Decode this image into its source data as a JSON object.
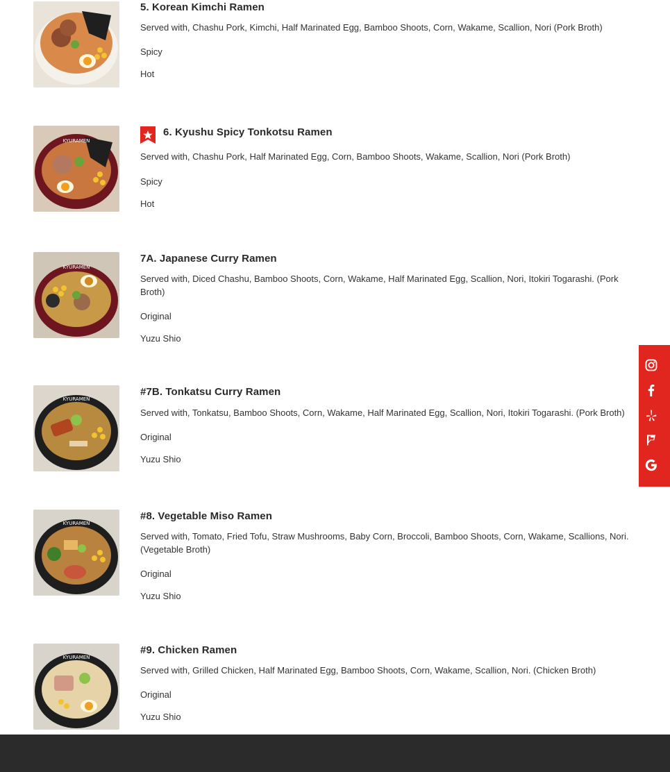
{
  "menu": {
    "items": [
      {
        "title": "5. Korean Kimchi Ramen",
        "featured": false,
        "description": "Served with, Chashu Pork, Kimchi, Half Marinated Egg, Bamboo Shoots, Corn, Wakame, Scallion, Nori (Pork Broth)",
        "options": [
          "Spicy",
          "Hot"
        ],
        "broth_color": "#d98a4a"
      },
      {
        "title": "6. Kyushu Spicy Tonkotsu Ramen",
        "featured": true,
        "description": "Served with, Chashu Pork, Half Marinated Egg, Corn, Bamboo Shoots, Wakame, Scallion, Nori (Pork Broth)",
        "options": [
          "Spicy",
          "Hot"
        ],
        "broth_color": "#c9773f"
      },
      {
        "title": "7A. Japanese Curry Ramen",
        "featured": false,
        "description": "Served with, Diced Chashu, Bamboo Shoots, Corn, Wakame, Half Marinated Egg, Scallion, Nori, Itokiri Togarashi. (Pork Broth)",
        "options": [
          "Original",
          "Yuzu Shio"
        ],
        "broth_color": "#c89a48"
      },
      {
        "title": "#7B. Tonkatsu Curry Ramen",
        "featured": false,
        "description": "Served with, Tonkatsu, Bamboo Shoots, Corn, Wakame, Half Marinated Egg, Scallion, Nori, Itokiri Togarashi. (Pork Broth)",
        "options": [
          "Original",
          "Yuzu Shio"
        ],
        "broth_color": "#b88a40"
      },
      {
        "title": "#8. Vegetable Miso Ramen",
        "featured": false,
        "description": "Served with, Tomato, Fried Tofu, Straw Mushrooms, Baby Corn, Broccoli, Bamboo Shoots, Corn, Wakame, Scallions, Nori. (Vegetable Broth)",
        "options": [
          "Original",
          "Yuzu Shio"
        ],
        "broth_color": "#b9823f"
      },
      {
        "title": "#9. Chicken Ramen",
        "featured": false,
        "description": "Served with, Grilled Chicken, Half Marinated Egg, Bamboo Shoots, Corn, Wakame, Scallion, Nori. (Chicken Broth)",
        "options": [
          "Original",
          "Yuzu Shio"
        ],
        "broth_color": "#e6d3a8"
      }
    ]
  },
  "social": {
    "icons": [
      "instagram-icon",
      "facebook-icon",
      "yelp-icon",
      "foursquare-icon",
      "google-icon"
    ],
    "color": "#e0261f"
  },
  "colors": {
    "accent": "#e0261f",
    "footer": "#2b2b2b"
  }
}
